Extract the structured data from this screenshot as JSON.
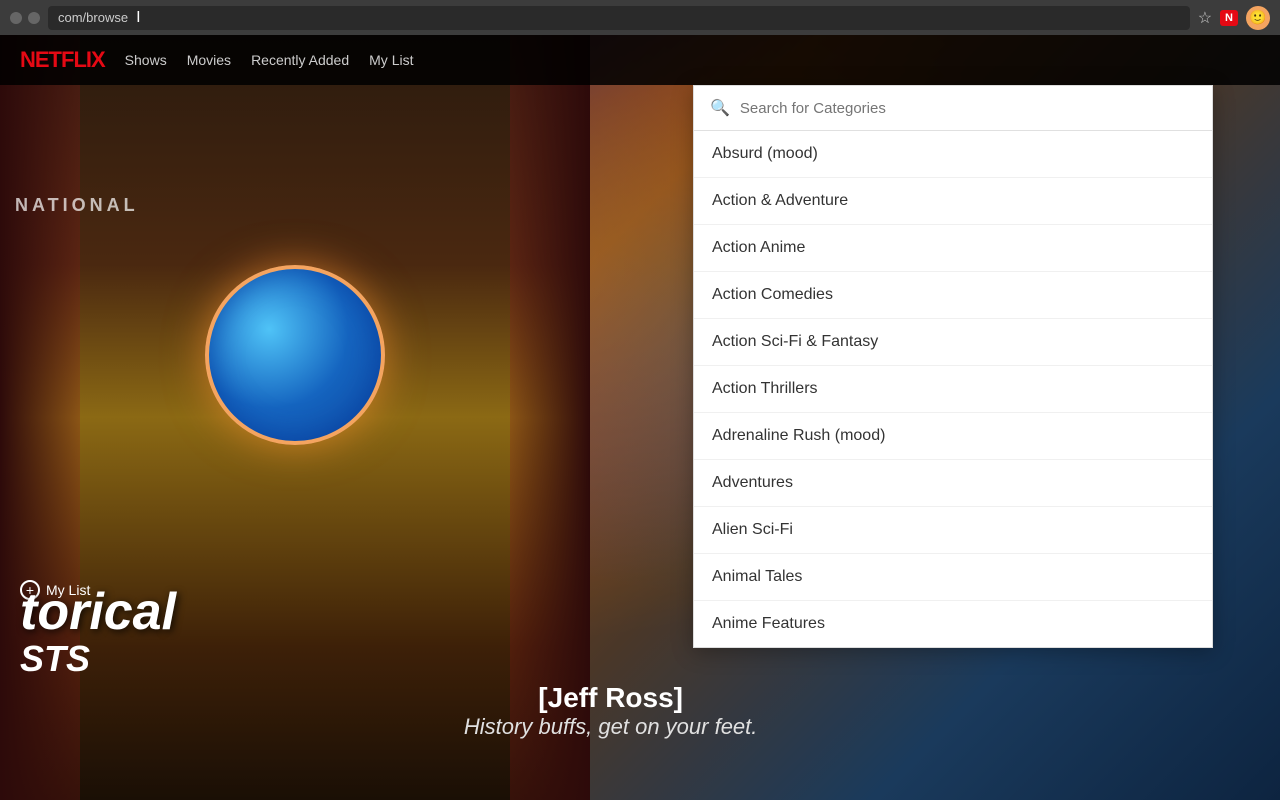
{
  "browser": {
    "url": "com/browse",
    "cursor_char": "I"
  },
  "nav": {
    "logo": "NETFLIX",
    "items": [
      "Shows",
      "Movies",
      "Recently Added",
      "My List"
    ]
  },
  "hero": {
    "national_label": "NATIONAL",
    "show_word1": "torical",
    "show_word2": "STS",
    "my_list_label": "My List",
    "speaker_label": "[Jeff Ross]",
    "quote_label": "History buffs, get on your feet."
  },
  "dropdown": {
    "search_placeholder": "Search for Categories",
    "categories": [
      "Absurd (mood)",
      "Action & Adventure",
      "Action Anime",
      "Action Comedies",
      "Action Sci-Fi & Fantasy",
      "Action Thrillers",
      "Adrenaline Rush (mood)",
      "Adventures",
      "Alien Sci-Fi",
      "Animal Tales",
      "Anime Features"
    ]
  }
}
